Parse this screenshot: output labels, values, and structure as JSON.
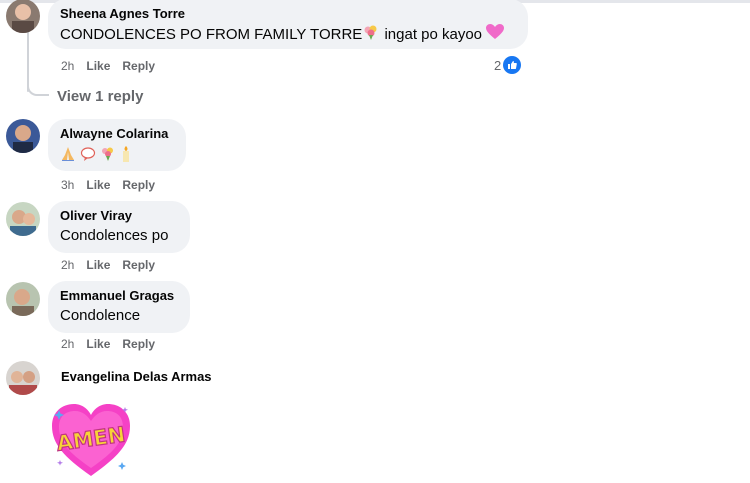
{
  "comments": [
    {
      "name": "Sheena Agnes Torre",
      "text": "CONDOLENCES PO FROM FAMILY TORRE",
      "text_tail": "ingat po kayoo",
      "time": "2h",
      "like": "Like",
      "reply": "Reply",
      "reaction_count": "2",
      "view_replies": "View 1 reply"
    },
    {
      "name": "Alwayne Colarina",
      "emojis": [
        "folded-hands-icon",
        "speech-bubble-icon",
        "bouquet-icon",
        "candle-icon"
      ],
      "time": "3h",
      "like": "Like",
      "reply": "Reply"
    },
    {
      "name": "Oliver Viray",
      "text": "Condolences po",
      "time": "2h",
      "like": "Like",
      "reply": "Reply"
    },
    {
      "name": "Emmanuel Gragas",
      "text": "Condolence",
      "time": "2h",
      "like": "Like",
      "reply": "Reply"
    },
    {
      "name": "Evangelina Delas Armas",
      "sticker_text": "AMEN"
    }
  ],
  "colors": {
    "bubble": "#f0f2f5",
    "meta": "#65676b",
    "like_blue": "#1877f2",
    "sticker_pink": "#f541c6"
  }
}
